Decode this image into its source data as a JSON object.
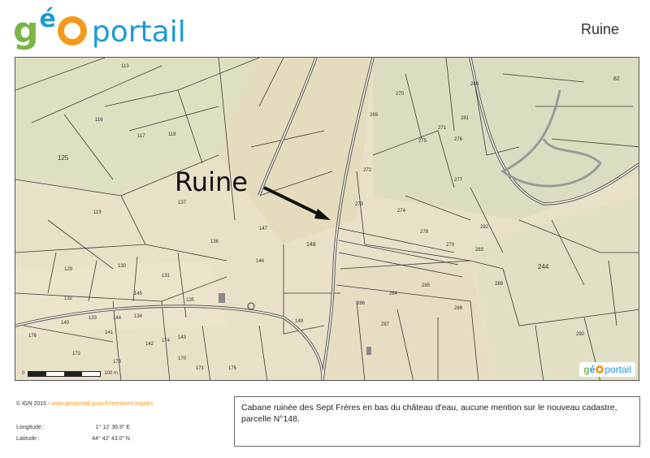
{
  "header": {
    "logo_text": "géoportail",
    "title": "Ruine"
  },
  "map": {
    "annotation": "Ruine",
    "parcels": [
      "125",
      "148",
      "244",
      "113",
      "116",
      "117",
      "118",
      "119",
      "129",
      "130",
      "131",
      "132",
      "133",
      "134",
      "135",
      "136",
      "137",
      "140",
      "141",
      "142",
      "143",
      "144",
      "145",
      "146",
      "147",
      "149",
      "170",
      "171",
      "172",
      "173",
      "174",
      "175",
      "176",
      "269",
      "270",
      "271",
      "272",
      "273",
      "274",
      "275",
      "276",
      "277",
      "278",
      "279",
      "280",
      "281",
      "282",
      "283",
      "284",
      "285",
      "286",
      "287",
      "288",
      "289",
      "290",
      "82"
    ],
    "scale_start": "0",
    "scale_label": "100 m",
    "overlay_logo_text": "géoportail"
  },
  "footer": {
    "copyright": "© IGN 2015 -",
    "copyright_link": "www.geoportail.gouv.fr/mentions-legales",
    "longitude_label": "Longitude :",
    "longitude_value": "1° 12' 36.9\" E",
    "latitude_label": "Latitude :",
    "latitude_value": "44° 42' 43.0\" N",
    "note": "Cabane ruinée des Sept Frères en bas du château d'eau, aucune mention sur le nouveau cadastre, parcelle N°148."
  },
  "colors": {
    "logo_green": "#7ab648",
    "logo_blue": "#1d9ad6",
    "logo_orange": "#f39a1d",
    "map_background": "#e9e0c8"
  }
}
